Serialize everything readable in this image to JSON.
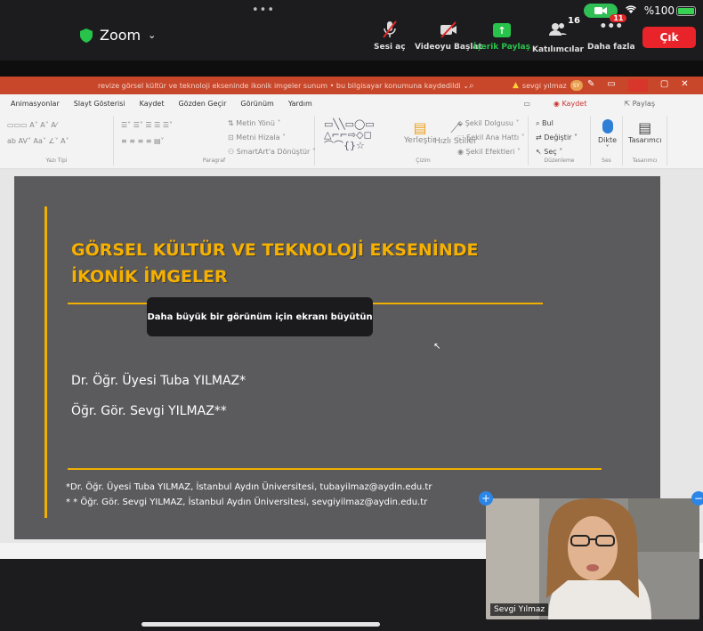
{
  "zoom": {
    "title": "Zoom",
    "controls": {
      "mute": "Sesi aç",
      "video": "Videoyu Başlat",
      "share": "İçerik Paylaş",
      "participants": "Katılımcılar",
      "participants_count": "16",
      "more": "Daha fazla",
      "more_badge": "11",
      "leave": "Çık"
    },
    "status": {
      "battery": "%100",
      "battery_fill": 1.0
    }
  },
  "ppt": {
    "title_bar": "revize görsel kültür ve teknoloji ekseninde ikonik imgeler sunum • bu bilgisayar konumuna kaydedildi ⌄",
    "user": "sevgi yılmaz",
    "user_initials": "SY",
    "tabs": [
      "Animasyonlar",
      "Slayt Gösterisi",
      "Kaydet",
      "Gözden Geçir",
      "Görünüm",
      "Yardım"
    ],
    "tabs_right": [
      "Kaydet",
      "Paylaş"
    ],
    "ribbon": {
      "font_group": "Yazı Tipi",
      "paragraph_group": "Paragraf",
      "drawing_group": "Çizim",
      "editing_group": "Düzenleme",
      "voice_group": "Ses",
      "designer_group": "Tasarımcı",
      "text_dir": "Metin Yönü",
      "align_text": "Metni Hizala",
      "smartart": "SmartArt'a Dönüştür",
      "arrange": "Yerleştir",
      "quick_styles": "Hızlı Stiller",
      "shape_fill": "Şekil Dolgusu",
      "shape_outline": "Şekil Ana Hattı",
      "shape_effects": "Şekil Efektleri",
      "find": "Bul",
      "replace": "Değiştir",
      "select": "Seç",
      "dictate": "Dikte",
      "designer": "Tasarımcı"
    }
  },
  "slide": {
    "title_line1": "GÖRSEL KÜLTÜR VE TEKNOLOJİ EKSENİNDE",
    "title_line2": "İKONİK İMGELER",
    "author1": "Dr. Öğr. Üyesi Tuba YILMAZ*",
    "author2": "Öğr. Gör. Sevgi YILMAZ**",
    "footnote1": "*Dr. Öğr. Üyesi Tuba YILMAZ, İstanbul Aydın Üniversitesi, tubayilmaz@aydin.edu.tr",
    "footnote2": "* * Öğr. Gör. Sevgi YILMAZ, İstanbul Aydın Üniversitesi, sevgiyilmaz@aydin.edu.tr"
  },
  "toast": "Daha büyük bir görünüm için ekranı büyütün",
  "pip": {
    "name": "Sevgi Yılmaz"
  },
  "colors": {
    "zoom_bg": "#1c1c1e",
    "ppt_accent": "#c8472a",
    "slide_bg": "#5b5a5d",
    "title_gold": "#f6b100",
    "leave_red": "#e8232a",
    "share_green": "#27c34b"
  }
}
